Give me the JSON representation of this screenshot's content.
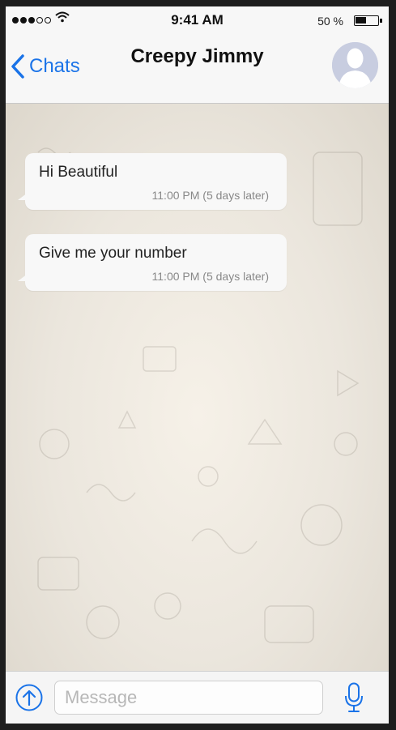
{
  "status_bar": {
    "signal_icon": "signal-dots-icon",
    "wifi_icon": "wifi-icon",
    "time": "9:41 AM",
    "battery_text": "50 %",
    "battery_level": 0.5
  },
  "nav": {
    "back_label": "Chats",
    "back_icon": "chevron-left-icon",
    "title": "Creepy Jimmy",
    "avatar_icon": "person-silhouette-icon"
  },
  "messages": [
    {
      "text": "Hi Beautiful",
      "time": "11:00 PM (5 days later)"
    },
    {
      "text": "Give me your number",
      "time": "11:00 PM (5 days later)"
    }
  ],
  "input": {
    "placeholder": "Message",
    "value": "",
    "send_icon": "arrow-up-circle-icon",
    "mic_icon": "microphone-icon"
  },
  "colors": {
    "accent": "#1a73e8",
    "bubble": "#f8f8f8",
    "chat_background": "#ebe6dd"
  }
}
